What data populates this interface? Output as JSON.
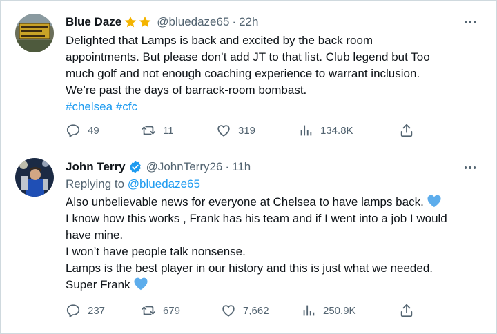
{
  "tweets": [
    {
      "author": "Blue Daze",
      "badge_emoji": "⭐⭐",
      "handle": "@bluedaze65",
      "time": "22h",
      "lines": [
        "Delighted that Lamps is back and excited by the back room",
        "appointments. But please don’t add JT to that list. Club legend but Too",
        "much golf and not enough coaching experience to warrant inclusion.",
        "We’re past the days of barrack-room bombast."
      ],
      "hashtags": "#chelsea #cfc",
      "stats": {
        "replies": "49",
        "retweets": "11",
        "likes": "319",
        "views": "134.8K"
      }
    },
    {
      "author": "John Terry",
      "handle": "@JohnTerry26",
      "time": "11h",
      "replying_prefix": "Replying to",
      "replying_to": "@bluedaze65",
      "lines": [
        "Also unbelievable news for everyone at Chelsea to have lamps back.",
        "I know how this works , Frank has his team and if I went into a job I would",
        "have mine.",
        "I won’t have people talk nonsense.",
        "Lamps is the best player in our history and this is just what we needed.",
        "Super Frank"
      ],
      "stats": {
        "replies": "237",
        "retweets": "679",
        "likes": "7,662",
        "views": "250.9K"
      }
    }
  ],
  "separator": "·",
  "colors": {
    "accent": "#1d9bf0",
    "muted": "#536471",
    "text": "#0f1419",
    "star": "#f4b400",
    "heart": "#5dadec"
  },
  "icons": [
    "star-icon",
    "verified-badge-icon",
    "more-icon",
    "reply-icon",
    "retweet-icon",
    "like-icon",
    "views-icon",
    "share-icon",
    "blue-heart-emoji"
  ]
}
